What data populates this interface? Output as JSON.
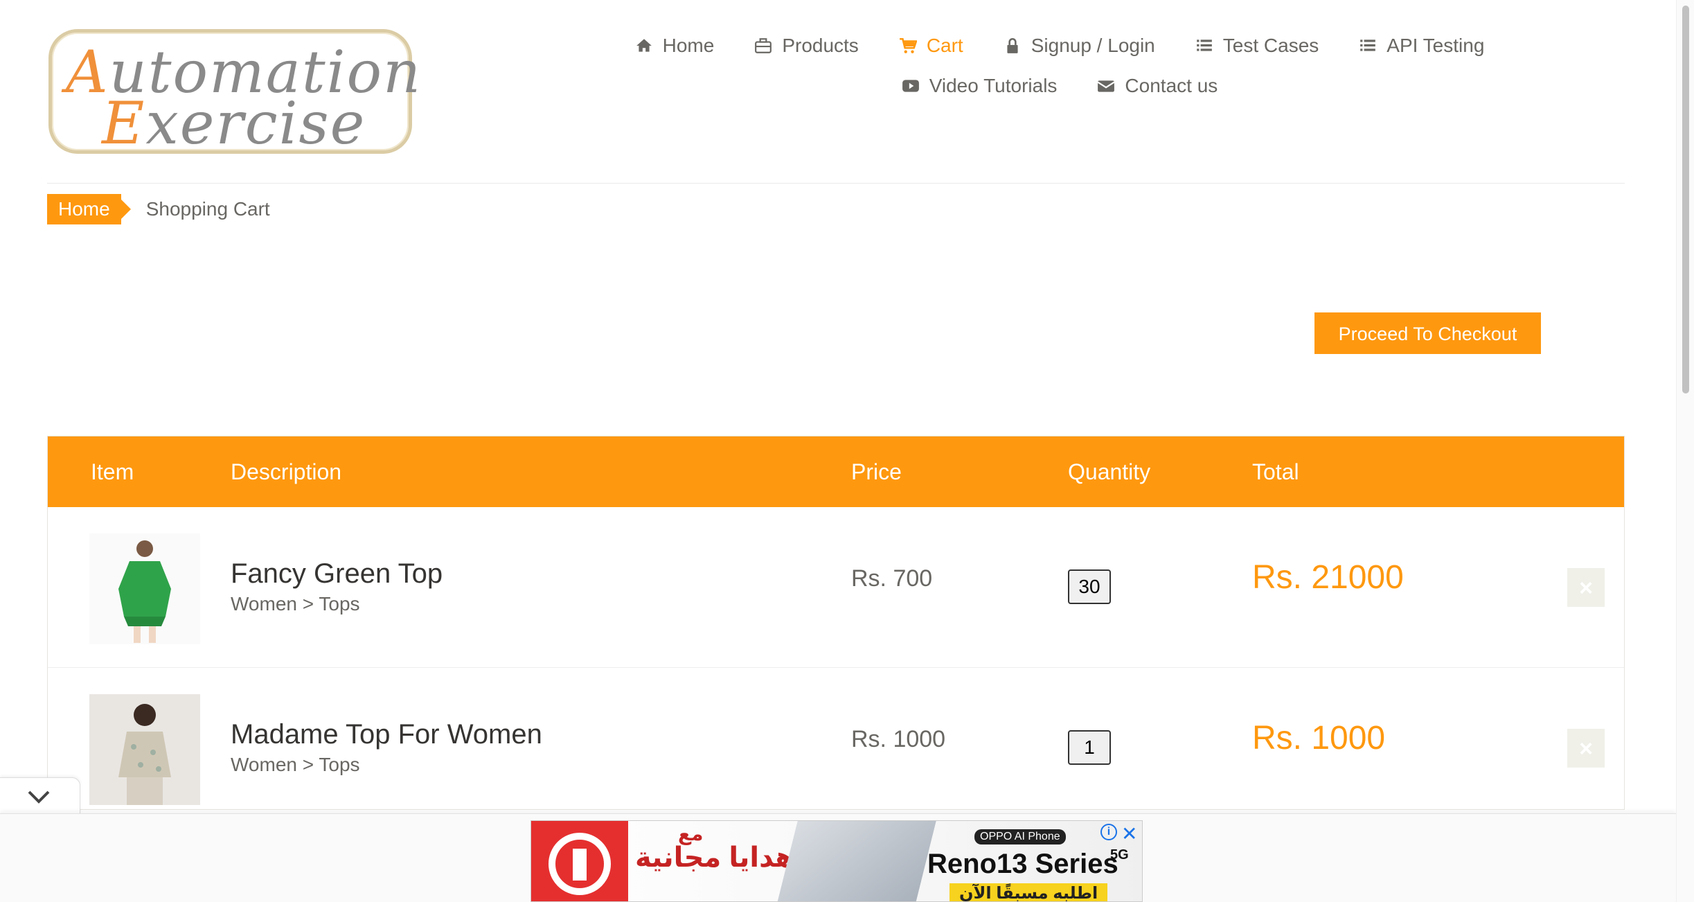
{
  "logo": {
    "line1": "utomation",
    "line1_cap": "A",
    "line2": "xercise",
    "line2_cap": "E"
  },
  "nav": {
    "home": "Home",
    "products": "Products",
    "cart": "Cart",
    "signup": "Signup / Login",
    "test_cases": "Test Cases",
    "api_testing": "API Testing",
    "video": "Video Tutorials",
    "contact": "Contact us"
  },
  "breadcrumb": {
    "home": "Home",
    "current": "Shopping Cart"
  },
  "checkout": {
    "label": "Proceed To Checkout"
  },
  "table": {
    "headers": [
      "Item",
      "Description",
      "Price",
      "Quantity",
      "Total"
    ],
    "rows": [
      {
        "name": "Fancy Green Top",
        "category": "Women > Tops",
        "price": "Rs. 700",
        "quantity": "30",
        "total": "Rs. 21000"
      },
      {
        "name": "Madame Top For Women",
        "category": "Women > Tops",
        "price": "Rs. 1000",
        "quantity": "1",
        "total": "Rs. 1000"
      }
    ],
    "delete_glyph": "×"
  },
  "ad": {
    "arabic_top": "مع",
    "arabic_main": "هدايا مجانية",
    "badge": "OPPO AI Phone",
    "series": "Reno13 Series",
    "g5": "5G",
    "cta": "اطلبه مسبقًا الآن",
    "info": "i",
    "close": "✕"
  },
  "colors": {
    "accent": "#FE980F",
    "text": "#696763",
    "heading": "#363432"
  }
}
